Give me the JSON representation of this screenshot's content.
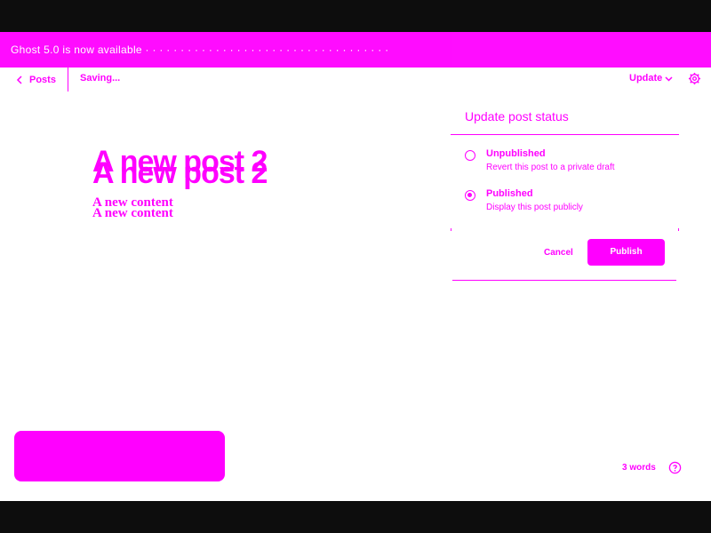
{
  "banner": {
    "text": "Ghost 5.0 is now available · · · · · · · · · · · · · · · · · · · · · · · · · · · · · · · · · · ·"
  },
  "editor_bar": {
    "back_label": "Posts",
    "status_text": "Saving...",
    "update_label": "Update",
    "icons": [
      "chevron-left-icon",
      "chevron-down-icon",
      "gear-icon"
    ]
  },
  "post": {
    "title": "A new post 2",
    "content": "A new content"
  },
  "status_popover": {
    "title": "Update post status",
    "options": [
      {
        "label": "Unpublished",
        "description": "Revert this post to a private draft",
        "selected": false
      },
      {
        "label": "Published",
        "description": "Display this post publicly",
        "selected": true
      }
    ],
    "cancel_label": "Cancel",
    "publish_label": "Publish"
  },
  "footer": {
    "word_count": "3 words",
    "help_icon": "help-icon"
  },
  "colors": {
    "accent": "#ff00ff",
    "background": "#ffffff",
    "letterbox": "#0d0d0d"
  }
}
